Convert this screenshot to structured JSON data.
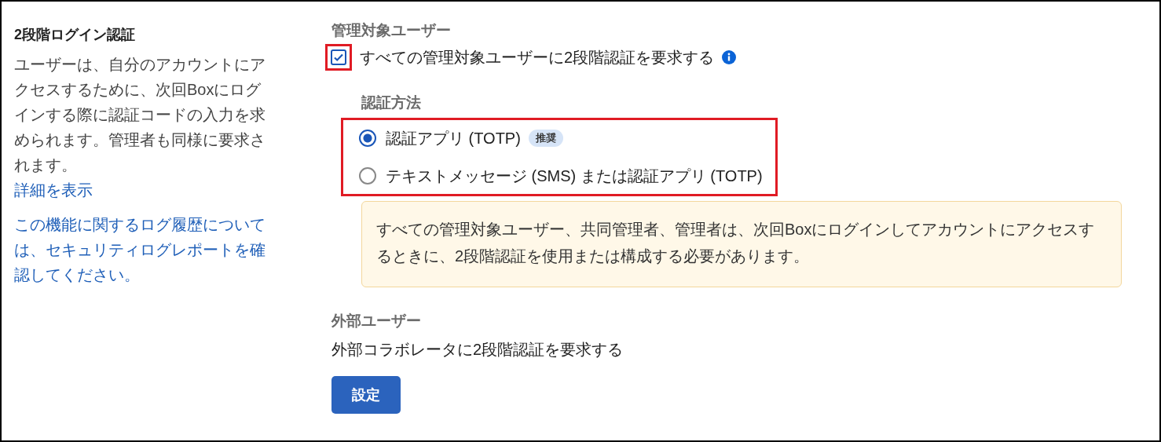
{
  "sidebar": {
    "title": "2段階ログイン認証",
    "description": "ユーザーは、自分のアカウントにアクセスするために、次回Boxにログインする際に認証コードの入力を求められます。管理者も同様に要求されます。",
    "details_link": "詳細を表示",
    "log_link": "この機能に関するログ履歴については、セキュリティログレポートを確認してください。"
  },
  "managed_users": {
    "heading": "管理対象ユーザー",
    "require_checkbox": {
      "label": "すべての管理対象ユーザーに2段階認証を要求する",
      "checked": true,
      "highlighted": true
    },
    "method": {
      "heading": "認証方法",
      "highlighted": true,
      "options": [
        {
          "label": "認証アプリ (TOTP)",
          "badge": "推奨",
          "selected": true
        },
        {
          "label": "テキストメッセージ (SMS) または認証アプリ (TOTP)",
          "selected": false
        }
      ]
    },
    "notice": "すべての管理対象ユーザー、共同管理者、管理者は、次回Boxにログインしてアカウントにアクセスするときに、2段階認証を使用または構成する必要があります。"
  },
  "external_users": {
    "heading": "外部ユーザー",
    "description": "外部コラボレータに2段階認証を要求する"
  },
  "save_button": "設定"
}
